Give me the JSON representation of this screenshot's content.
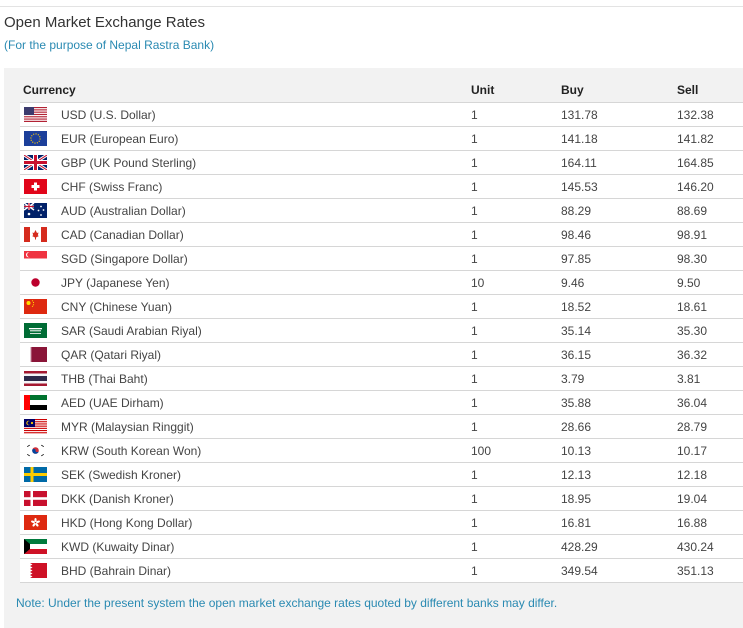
{
  "title": "Open Market Exchange Rates",
  "subtitle": "(For the purpose of Nepal Rastra Bank)",
  "table": {
    "headers": {
      "currency": "Currency",
      "unit": "Unit",
      "buy": "Buy",
      "sell": "Sell"
    },
    "rows": [
      {
        "flag": "usa-flag-icon",
        "currency": "USD (U.S. Dollar)",
        "unit": "1",
        "buy": "131.78",
        "sell": "132.38"
      },
      {
        "flag": "eu-flag-icon",
        "currency": "EUR (European Euro)",
        "unit": "1",
        "buy": "141.18",
        "sell": "141.82"
      },
      {
        "flag": "uk-flag-icon",
        "currency": "GBP (UK Pound Sterling)",
        "unit": "1",
        "buy": "164.11",
        "sell": "164.85"
      },
      {
        "flag": "switzerland-flag-icon",
        "currency": "CHF (Swiss Franc)",
        "unit": "1",
        "buy": "145.53",
        "sell": "146.20"
      },
      {
        "flag": "australia-flag-icon",
        "currency": "AUD (Australian Dollar)",
        "unit": "1",
        "buy": "88.29",
        "sell": "88.69"
      },
      {
        "flag": "canada-flag-icon",
        "currency": "CAD (Canadian Dollar)",
        "unit": "1",
        "buy": "98.46",
        "sell": "98.91"
      },
      {
        "flag": "singapore-flag-icon",
        "currency": "SGD (Singapore Dollar)",
        "unit": "1",
        "buy": "97.85",
        "sell": "98.30"
      },
      {
        "flag": "japan-flag-icon",
        "currency": "JPY (Japanese Yen)",
        "unit": "10",
        "buy": "9.46",
        "sell": "9.50"
      },
      {
        "flag": "china-flag-icon",
        "currency": "CNY (Chinese Yuan)",
        "unit": "1",
        "buy": "18.52",
        "sell": "18.61"
      },
      {
        "flag": "saudi-arabia-flag-icon",
        "currency": "SAR (Saudi Arabian Riyal)",
        "unit": "1",
        "buy": "35.14",
        "sell": "35.30"
      },
      {
        "flag": "qatar-flag-icon",
        "currency": "QAR (Qatari Riyal)",
        "unit": "1",
        "buy": "36.15",
        "sell": "36.32"
      },
      {
        "flag": "thailand-flag-icon",
        "currency": "THB (Thai Baht)",
        "unit": "1",
        "buy": "3.79",
        "sell": "3.81"
      },
      {
        "flag": "uae-flag-icon",
        "currency": "AED (UAE Dirham)",
        "unit": "1",
        "buy": "35.88",
        "sell": "36.04"
      },
      {
        "flag": "malaysia-flag-icon",
        "currency": "MYR (Malaysian Ringgit)",
        "unit": "1",
        "buy": "28.66",
        "sell": "28.79"
      },
      {
        "flag": "south-korea-flag-icon",
        "currency": "KRW (South Korean Won)",
        "unit": "100",
        "buy": "10.13",
        "sell": "10.17"
      },
      {
        "flag": "sweden-flag-icon",
        "currency": "SEK (Swedish Kroner)",
        "unit": "1",
        "buy": "12.13",
        "sell": "12.18"
      },
      {
        "flag": "denmark-flag-icon",
        "currency": "DKK (Danish Kroner)",
        "unit": "1",
        "buy": "18.95",
        "sell": "19.04"
      },
      {
        "flag": "hong-kong-flag-icon",
        "currency": "HKD (Hong Kong Dollar)",
        "unit": "1",
        "buy": "16.81",
        "sell": "16.88"
      },
      {
        "flag": "kuwait-flag-icon",
        "currency": "KWD (Kuwaity Dinar)",
        "unit": "1",
        "buy": "428.29",
        "sell": "430.24"
      },
      {
        "flag": "bahrain-flag-icon",
        "currency": "BHD (Bahrain Dinar)",
        "unit": "1",
        "buy": "349.54",
        "sell": "351.13"
      }
    ]
  },
  "note": "Note: Under the present system the open market exchange rates quoted by different banks may differ.",
  "colors": {
    "accent": "#2a8ab2",
    "panel": "#f2f2f2",
    "row_border": "#d6d6d6"
  }
}
